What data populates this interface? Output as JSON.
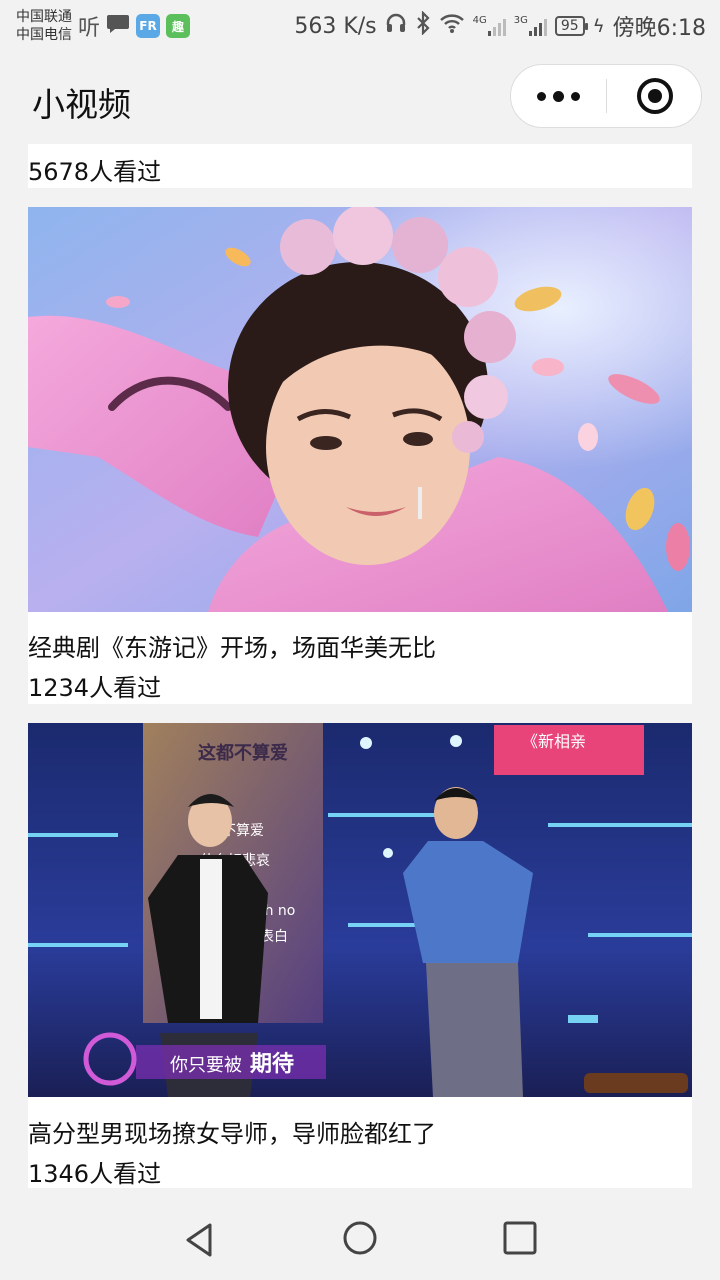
{
  "status_bar": {
    "carrier_1": "中国联通",
    "carrier_2": "中国电信",
    "listen_icon_text": "听",
    "speed": "563 K/s",
    "network_1": "4G",
    "network_2": "3G",
    "battery": "95",
    "time": "傍晚6:18"
  },
  "header": {
    "title": "小视频"
  },
  "feed": [
    {
      "views": "5678人看过"
    },
    {
      "title": "经典剧《东游记》开场，场面华美无比",
      "views": "1234人看过"
    },
    {
      "title": "高分型男现场撩女导师，导师脸都红了",
      "views": "1346人看过"
    }
  ],
  "thumb2": {
    "overlay_top": "这都不算爱",
    "overlay_badge": "《新相亲",
    "lyrics": [
      "都不算爱",
      "什么好悲哀",
      "oh no",
      "表白"
    ],
    "subtitle_a": "你只要被",
    "subtitle_b": "期待"
  },
  "colors": {
    "background": "#f2f2f2",
    "card": "#ffffff",
    "text": "#111111"
  }
}
